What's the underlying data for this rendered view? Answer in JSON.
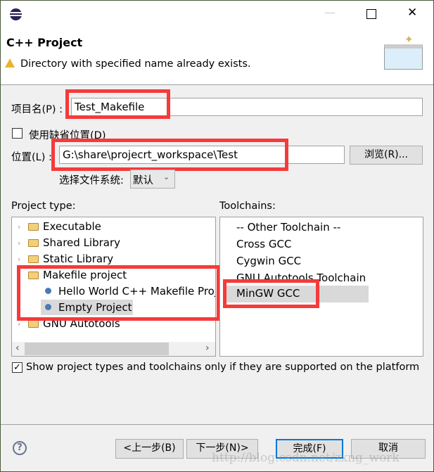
{
  "titlebar": {
    "minimize": "—",
    "maximize": "☐",
    "close": "✕"
  },
  "header": {
    "title": "C++ Project",
    "message": "Directory with specified name already exists."
  },
  "form": {
    "project_name_label": "项目名(P) :",
    "project_name_value": "Test_Makefile",
    "use_default_label": "使用缺省位置(D)",
    "use_default_checked": false,
    "location_label": "位置(L) :",
    "location_value": "G:\\share\\projecrt_workspace\\Test",
    "browse_label": "浏览(R)...",
    "filesystem_label": "选择文件系统:",
    "filesystem_value": "默认"
  },
  "project_type": {
    "label": "Project type:",
    "items": [
      {
        "label": "Executable",
        "kind": "folder",
        "expanded": false
      },
      {
        "label": "Shared Library",
        "kind": "folder",
        "expanded": false
      },
      {
        "label": "Static Library",
        "kind": "folder",
        "expanded": false
      },
      {
        "label": "Makefile project",
        "kind": "folder",
        "expanded": true
      },
      {
        "label": "Hello World C++ Makefile Project",
        "kind": "leaf"
      },
      {
        "label": "Empty Project",
        "kind": "leaf",
        "selected": true
      },
      {
        "label": "GNU Autotools",
        "kind": "folder",
        "expanded": false
      }
    ]
  },
  "toolchains": {
    "label": "Toolchains:",
    "items": [
      "-- Other Toolchain --",
      "Cross GCC",
      "Cygwin GCC",
      "GNU Autotools Toolchain",
      "MinGW GCC"
    ],
    "selected": "MinGW GCC"
  },
  "show_supported": {
    "label": "Show project types and toolchains only if they are supported on the platform",
    "checked": true
  },
  "buttons": {
    "back": "<上一步(B)",
    "next": "下一步(N)>",
    "finish": "完成(F)",
    "cancel": "取消"
  },
  "watermark": "http://blog.csdn.net/zxng_work",
  "colors": {
    "highlight": "#f63a3a",
    "selection": "#d9d9d9",
    "default_button": "#0078d7"
  }
}
